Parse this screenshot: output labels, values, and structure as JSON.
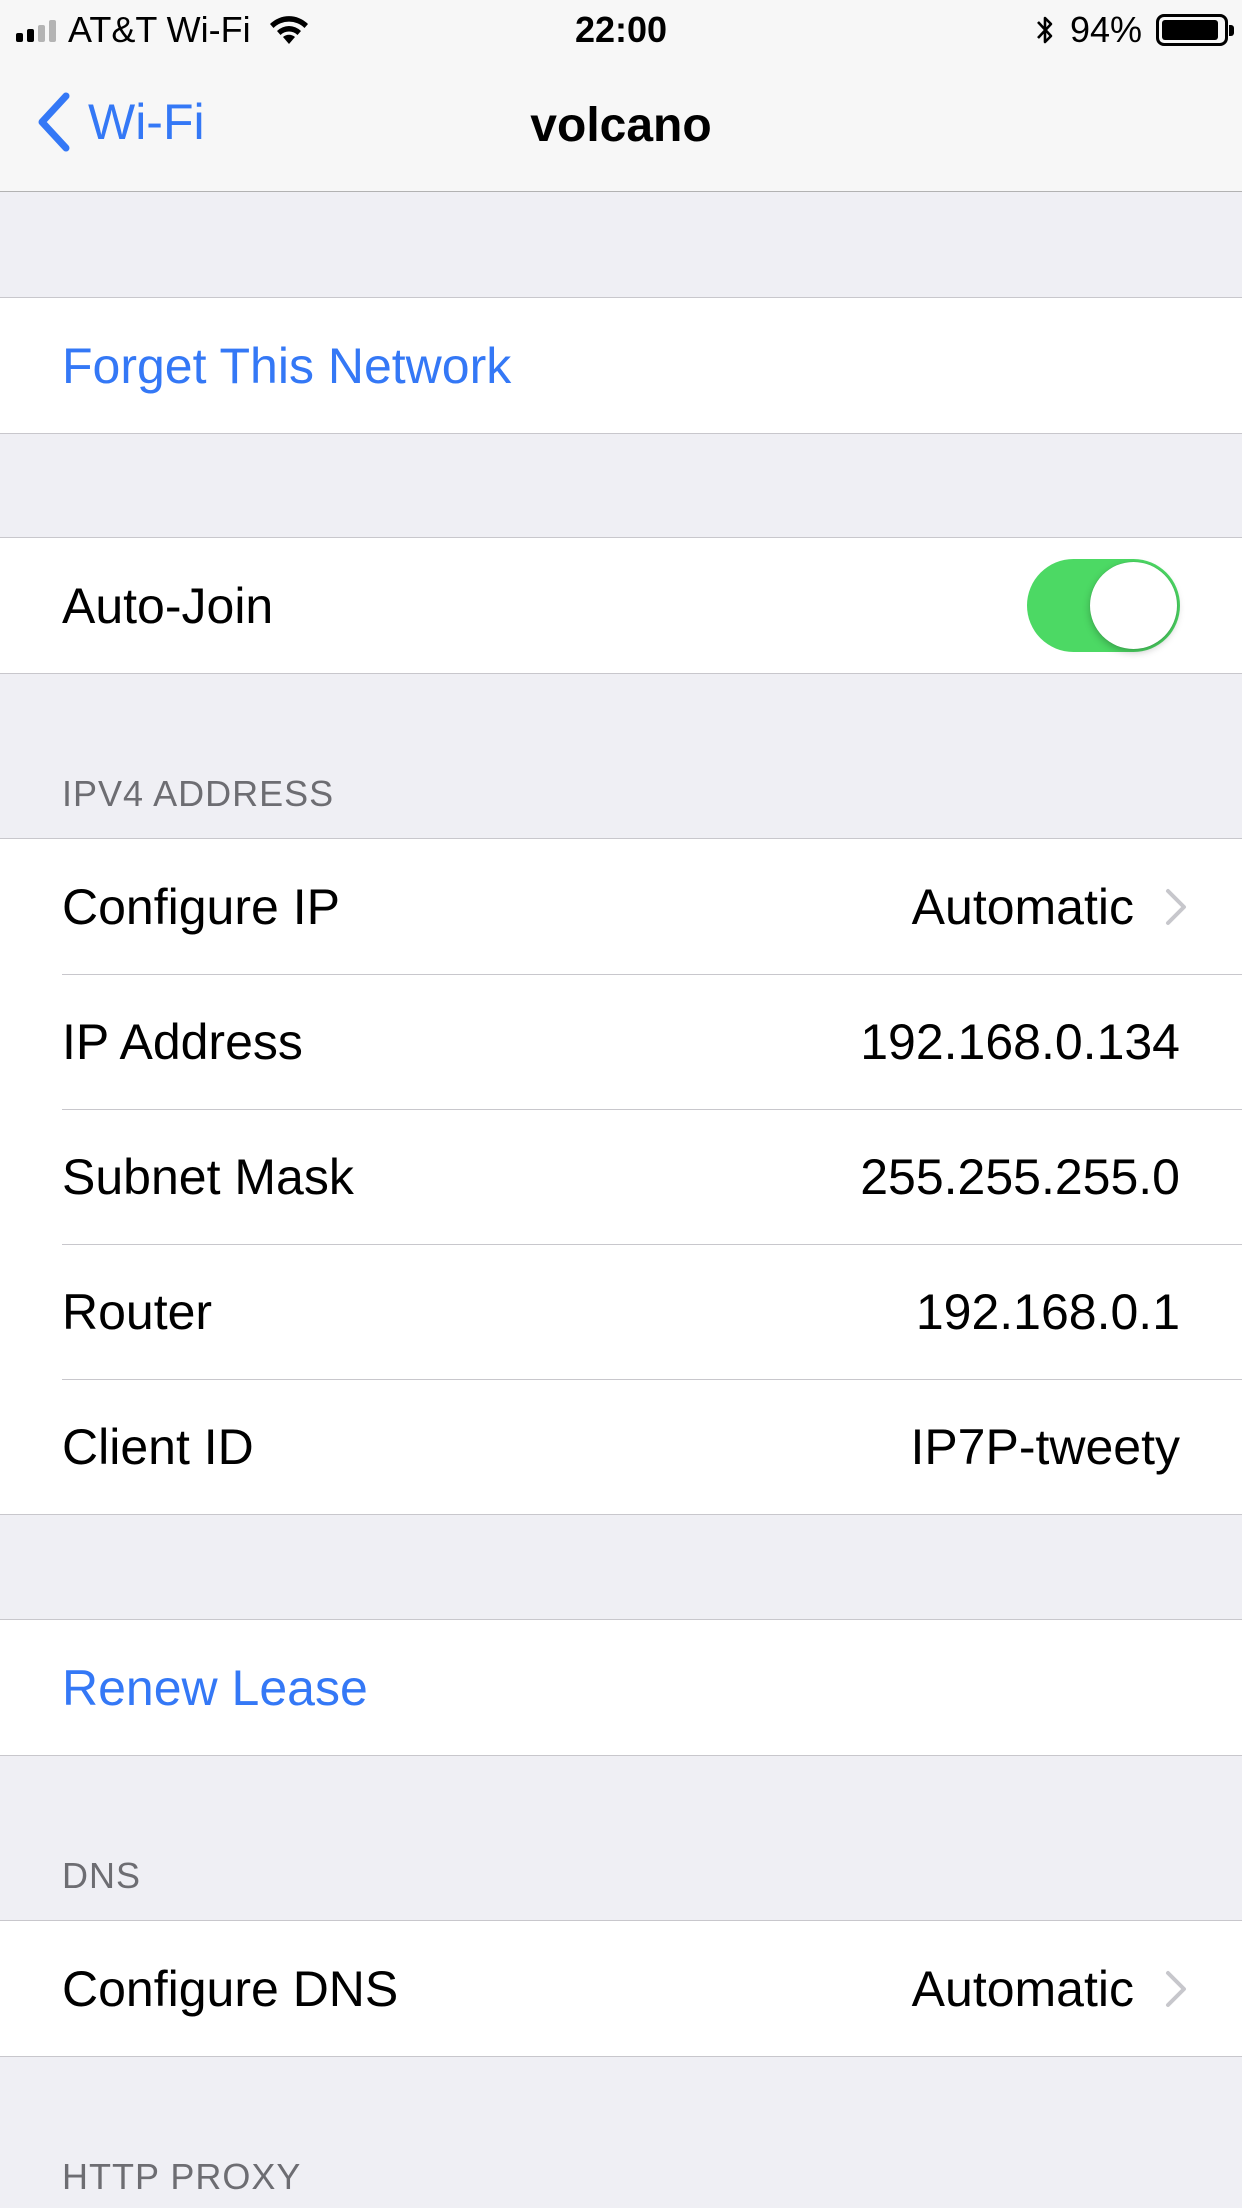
{
  "status_bar": {
    "carrier": "AT&T Wi-Fi",
    "time": "22:00",
    "battery": "94%",
    "battery_level": 0.94,
    "signal_bars": 4,
    "signal_strength": 2
  },
  "nav": {
    "back_label": "Wi-Fi",
    "title": "volcano"
  },
  "forget_network": {
    "label": "Forget This Network"
  },
  "auto_join": {
    "label": "Auto-Join",
    "enabled": true
  },
  "ipv4": {
    "header": "IPV4 ADDRESS",
    "configure_ip": {
      "label": "Configure IP",
      "value": "Automatic"
    },
    "ip_address": {
      "label": "IP Address",
      "value": "192.168.0.134"
    },
    "subnet_mask": {
      "label": "Subnet Mask",
      "value": "255.255.255.0"
    },
    "router": {
      "label": "Router",
      "value": "192.168.0.1"
    },
    "client_id": {
      "label": "Client ID",
      "value": "IP7P-tweety"
    }
  },
  "renew_lease": {
    "label": "Renew Lease"
  },
  "dns": {
    "header": "DNS",
    "configure_dns": {
      "label": "Configure DNS",
      "value": "Automatic"
    }
  },
  "http_proxy": {
    "header": "HTTP PROXY"
  },
  "colors": {
    "accent": "#3478f6",
    "toggle_on": "#4cd964",
    "background": "#efeff4"
  }
}
